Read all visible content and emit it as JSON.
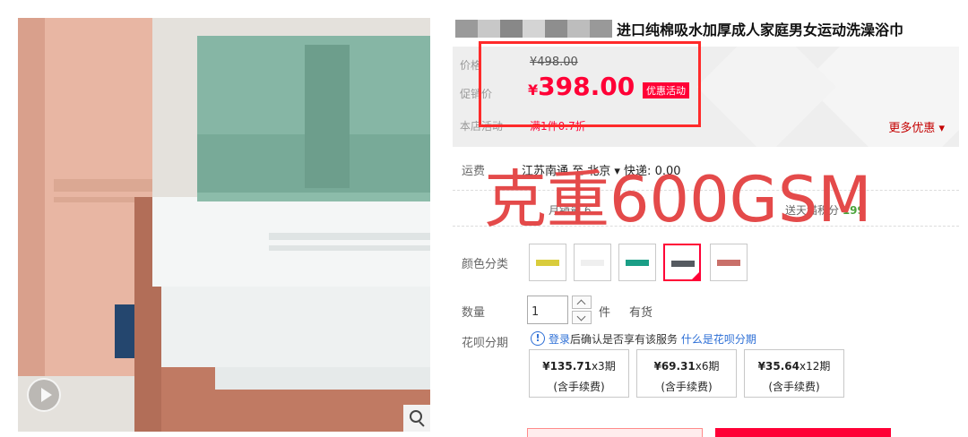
{
  "title": {
    "redacted_blocks": [
      "#9a9a9a",
      "#c8c8c8",
      "#888888",
      "#d4d4d4",
      "#8e8e8e",
      "#bdbdbd",
      "#999999"
    ],
    "text": "进口纯棉吸水加厚成人家庭男女运动洗澡浴巾"
  },
  "price": {
    "label_original": "价格",
    "original": "¥498.00",
    "label_promo": "促销价",
    "promo_yen": "¥",
    "promo_value": "398.00",
    "promo_tag": "优惠活动",
    "label_shop": "本店活动",
    "shop_activity": "满1件0.7折",
    "more_promos": "更多优惠 ▾"
  },
  "freight": {
    "label": "运费",
    "text": "江苏南通  至  北京 ▾  快递: 0.00"
  },
  "sales": {
    "monthly": "月销量 6",
    "points": "送天猫积分 ",
    "points_value": "199"
  },
  "overlay_text": "克重600GSM",
  "color": {
    "label": "颜色分类",
    "swatches": [
      {
        "name": "yellow",
        "color": "#d9cc3c"
      },
      {
        "name": "white",
        "color": "#efefef"
      },
      {
        "name": "teal",
        "color": "#1a9e86"
      },
      {
        "name": "gray",
        "color": "#555a60"
      },
      {
        "name": "pink",
        "color": "#c9706a"
      }
    ],
    "selected_index": 3
  },
  "quantity": {
    "label": "数量",
    "value": "1",
    "unit": "件",
    "stock": "有货"
  },
  "huabei": {
    "label": "花呗分期",
    "info_icon": "info-icon",
    "login": "登录",
    "notice": "后确认是否享有该服务",
    "link": "什么是花呗分期",
    "plans": [
      {
        "amount": "¥135.71",
        "terms": "x3期",
        "fee": "(含手续费)"
      },
      {
        "amount": "¥69.31",
        "terms": "x6期",
        "fee": "(含手续费)"
      },
      {
        "amount": "¥35.64",
        "terms": "x12期",
        "fee": "(含手续费)"
      }
    ]
  },
  "colors": {
    "accent": "#ff0036",
    "annotation_box": "#ff2a2a",
    "link": "#2d6fd6"
  }
}
